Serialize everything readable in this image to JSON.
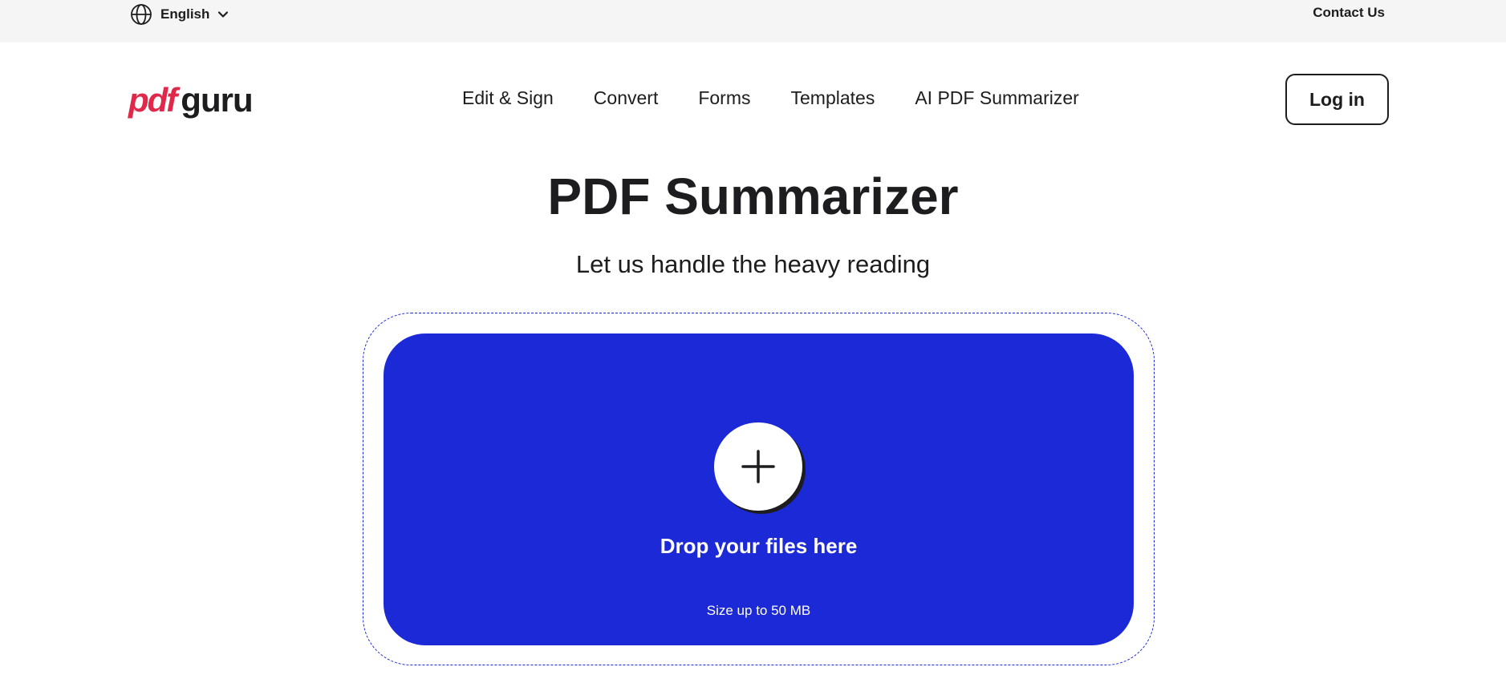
{
  "topbar": {
    "language": "English",
    "contact_label": "Contact Us"
  },
  "header": {
    "logo_pdf": "pdf",
    "logo_guru": "guru",
    "nav": [
      "Edit & Sign",
      "Convert",
      "Forms",
      "Templates",
      "AI PDF Summarizer"
    ],
    "login_label": "Log in"
  },
  "hero": {
    "title": "PDF Summarizer",
    "subtitle": "Let us handle the heavy reading"
  },
  "upload": {
    "drop_label": "Drop your files here",
    "size_label": "Size up to 50 MB"
  },
  "colors": {
    "brand_red": "#e0294a",
    "drop_blue": "#1b2ad6",
    "text": "#1d1d1f",
    "topbar_bg": "#f5f5f5"
  },
  "icons": {
    "language": "globe-icon",
    "dropdown": "chevron-down-icon",
    "upload": "plus-icon"
  }
}
